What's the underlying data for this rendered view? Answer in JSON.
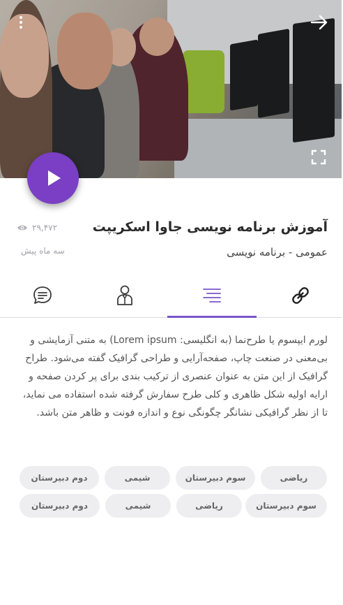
{
  "hero": {
    "icons": {
      "menu": "more-vertical-icon",
      "back": "arrow-right-icon",
      "fullscreen": "fullscreen-icon",
      "play": "play-icon"
    }
  },
  "course": {
    "title": "آموزش برنامه نویسی جاوا اسکریپت",
    "category": "عمومی - برنامه نویسی",
    "views": "۲۹,۴۷۲",
    "date": "سه ماه پیش"
  },
  "tabs": [
    {
      "icon": "link-icon",
      "active": false
    },
    {
      "icon": "list-icon",
      "active": true
    },
    {
      "icon": "user-icon",
      "active": false
    },
    {
      "icon": "comment-icon",
      "active": false
    }
  ],
  "description": "لورم ایپسوم یا طرح‌نما (به انگلیسی: Lorem ipsum) به متنی آزمایشی و بی‌معنی در صنعت چاپ، صفحه‌آرایی و طراحی گرافیک گفته می‌شود. طراح گرافیک از این متن به عنوان عنصری از ترکیب بندی برای پر کردن صفحه و ارایه اولیه شکل ظاهری و کلی طرح سفارش گرفته شده استفاده می نماید، تا از نظر گرافیکی نشانگر چگونگی نوع و اندازه فونت و ظاهر متن باشد.",
  "tags": [
    "ریاضی",
    "سوم دبیرستان",
    "شیمی",
    "دوم دبیرستان",
    "سوم دبیرستان",
    "ریاضی",
    "شیمی",
    "دوم دبیرستان"
  ],
  "colors": {
    "accent": "#7a3fc4",
    "tab_indicator": "#7a55c9",
    "tag_bg": "#eeeef1",
    "muted_text": "#a2a2a8"
  }
}
